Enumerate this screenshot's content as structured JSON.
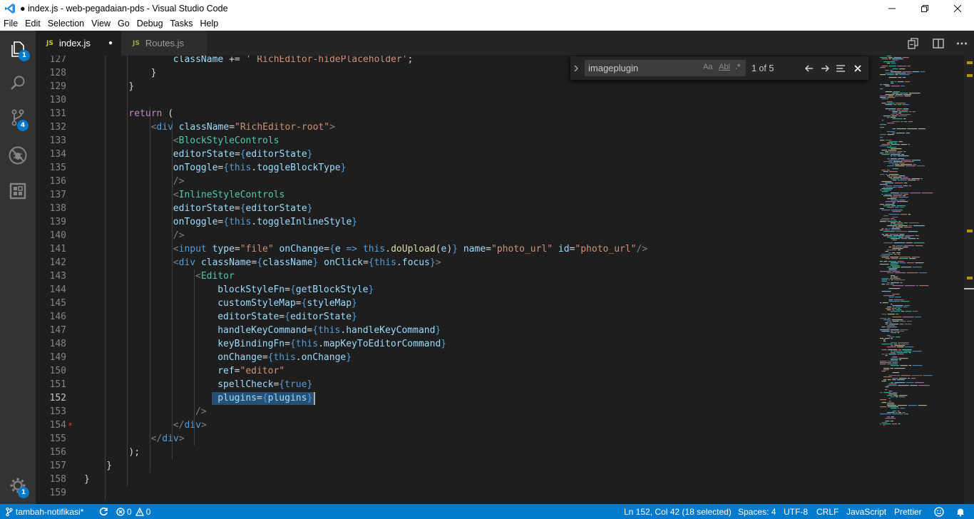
{
  "window": {
    "title": "● index.js - web-pegadaian-pds - Visual Studio Code",
    "controls": {
      "minimize": "—",
      "restore": "❐",
      "close": "✕"
    }
  },
  "menu": [
    "File",
    "Edit",
    "Selection",
    "View",
    "Go",
    "Debug",
    "Tasks",
    "Help"
  ],
  "activity": {
    "explorer_badge": "1",
    "scm_badge": "4",
    "settings_badge": "1"
  },
  "tabs": [
    {
      "icon": "JS",
      "label": "index.js",
      "dirty": "●"
    },
    {
      "icon": "JS",
      "label": "Routes.js"
    }
  ],
  "find": {
    "query": "imageplugin",
    "opt_case": "Aa",
    "opt_word": "Abl",
    "opt_regex": ".*",
    "match_count": "1 of 5"
  },
  "editor": {
    "current_line": "152",
    "lines": [
      {
        "n": "127",
        "indent": 4,
        "html": "<span class='t-var'>className</span> <span class='t-pun'>+=</span> <span class='t-str'>' RichEditor-hidePlaceholder'</span><span class='t-pun'>;</span>"
      },
      {
        "n": "128",
        "indent": 3,
        "html": "<span class='t-pun'>}</span>"
      },
      {
        "n": "129",
        "indent": 2,
        "html": "<span class='t-pun'>}</span>"
      },
      {
        "n": "130",
        "indent": 0,
        "html": ""
      },
      {
        "n": "131",
        "indent": 2,
        "html": "<span class='t-kw'>return</span> <span class='t-pun'>(</span>"
      },
      {
        "n": "132",
        "indent": 3,
        "html": "<span class='t-br'>&lt;</span><span class='t-tag'>div</span> <span class='t-attr'>className</span><span class='t-pun'>=</span><span class='t-str'>\"RichEditor-root\"</span><span class='t-br'>&gt;</span>"
      },
      {
        "n": "133",
        "indent": 4,
        "html": "<span class='t-br'>&lt;</span><span class='t-comp'>BlockStyleControls</span>"
      },
      {
        "n": "134",
        "indent": 4,
        "html": "<span class='t-attr'>editorState</span><span class='t-pun'>=</span><span class='t-tag'>{</span><span class='t-var'>editorState</span><span class='t-tag'>}</span>"
      },
      {
        "n": "135",
        "indent": 4,
        "html": "<span class='t-attr'>onToggle</span><span class='t-pun'>=</span><span class='t-tag'>{</span><span class='t-this'>this</span><span class='t-pun'>.</span><span class='t-var'>toggleBlockType</span><span class='t-tag'>}</span>"
      },
      {
        "n": "136",
        "indent": 4,
        "html": "<span class='t-br'>/&gt;</span>"
      },
      {
        "n": "137",
        "indent": 4,
        "html": "<span class='t-br'>&lt;</span><span class='t-comp'>InlineStyleControls</span>"
      },
      {
        "n": "138",
        "indent": 4,
        "html": "<span class='t-attr'>editorState</span><span class='t-pun'>=</span><span class='t-tag'>{</span><span class='t-var'>editorState</span><span class='t-tag'>}</span>"
      },
      {
        "n": "139",
        "indent": 4,
        "html": "<span class='t-attr'>onToggle</span><span class='t-pun'>=</span><span class='t-tag'>{</span><span class='t-this'>this</span><span class='t-pun'>.</span><span class='t-var'>toggleInlineStyle</span><span class='t-tag'>}</span>"
      },
      {
        "n": "140",
        "indent": 4,
        "html": "<span class='t-br'>/&gt;</span>"
      },
      {
        "n": "141",
        "indent": 4,
        "html": "<span class='t-br'>&lt;</span><span class='t-tag'>input</span> <span class='t-attr'>type</span><span class='t-pun'>=</span><span class='t-str'>\"file\"</span> <span class='t-attr'>onChange</span><span class='t-pun'>=</span><span class='t-tag'>{</span><span class='t-var'>e</span> <span class='t-tag'>=&gt;</span> <span class='t-this'>this</span><span class='t-pun'>.</span><span class='t-fn'>doUpload</span><span class='t-pun'>(</span><span class='t-var'>e</span><span class='t-pun'>)</span><span class='t-tag'>}</span> <span class='t-attr'>name</span><span class='t-pun'>=</span><span class='t-str'>\"photo_url\"</span> <span class='t-attr'>id</span><span class='t-pun'>=</span><span class='t-str'>\"photo_url\"</span><span class='t-br'>/&gt;</span>"
      },
      {
        "n": "142",
        "indent": 4,
        "html": "<span class='t-br'>&lt;</span><span class='t-tag'>div</span> <span class='t-attr'>className</span><span class='t-pun'>=</span><span class='t-tag'>{</span><span class='t-var'>className</span><span class='t-tag'>}</span> <span class='t-attr'>onClick</span><span class='t-pun'>=</span><span class='t-tag'>{</span><span class='t-this'>this</span><span class='t-pun'>.</span><span class='t-var'>focus</span><span class='t-tag'>}</span><span class='t-br'>&gt;</span>"
      },
      {
        "n": "143",
        "indent": 5,
        "html": "<span class='t-br'>&lt;</span><span class='t-comp'>Editor</span>"
      },
      {
        "n": "144",
        "indent": 6,
        "html": "<span class='t-attr'>blockStyleFn</span><span class='t-pun'>=</span><span class='t-tag'>{</span><span class='t-var'>getBlockStyle</span><span class='t-tag'>}</span>"
      },
      {
        "n": "145",
        "indent": 6,
        "html": "<span class='t-attr'>customStyleMap</span><span class='t-pun'>=</span><span class='t-tag'>{</span><span class='t-var'>styleMap</span><span class='t-tag'>}</span>"
      },
      {
        "n": "146",
        "indent": 6,
        "html": "<span class='t-attr'>editorState</span><span class='t-pun'>=</span><span class='t-tag'>{</span><span class='t-var'>editorState</span><span class='t-tag'>}</span>"
      },
      {
        "n": "147",
        "indent": 6,
        "html": "<span class='t-attr'>handleKeyCommand</span><span class='t-pun'>=</span><span class='t-tag'>{</span><span class='t-this'>this</span><span class='t-pun'>.</span><span class='t-var'>handleKeyCommand</span><span class='t-tag'>}</span>"
      },
      {
        "n": "148",
        "indent": 6,
        "html": "<span class='t-attr'>keyBindingFn</span><span class='t-pun'>=</span><span class='t-tag'>{</span><span class='t-this'>this</span><span class='t-pun'>.</span><span class='t-var'>mapKeyToEditorCommand</span><span class='t-tag'>}</span>"
      },
      {
        "n": "149",
        "indent": 6,
        "html": "<span class='t-attr'>onChange</span><span class='t-pun'>=</span><span class='t-tag'>{</span><span class='t-this'>this</span><span class='t-pun'>.</span><span class='t-var'>onChange</span><span class='t-tag'>}</span>"
      },
      {
        "n": "150",
        "indent": 6,
        "html": "<span class='t-attr'>ref</span><span class='t-pun'>=</span><span class='t-str'>\"editor\"</span>"
      },
      {
        "n": "151",
        "indent": 6,
        "html": "<span class='t-attr'>spellCheck</span><span class='t-pun'>=</span><span class='t-tag'>{</span><span class='t-this'>true</span><span class='t-tag'>}</span>"
      },
      {
        "n": "152",
        "indent": 6,
        "html": "<span class='t-attr'>plugins</span><span class='t-pun'>=</span><span class='t-tag'>{</span><span class='t-var'>plugins</span><span class='t-tag'>}</span>"
      },
      {
        "n": "153",
        "indent": 5,
        "html": "<span class='t-br'>/&gt;</span>"
      },
      {
        "n": "154",
        "indent": 4,
        "html": "<span class='t-br'>&lt;/</span><span class='t-tag'>div</span><span class='t-br'>&gt;</span>"
      },
      {
        "n": "155",
        "indent": 3,
        "html": "<span class='t-br'>&lt;/</span><span class='t-tag'>div</span><span class='t-br'>&gt;</span>"
      },
      {
        "n": "156",
        "indent": 2,
        "html": "<span class='t-pun'>);</span>"
      },
      {
        "n": "157",
        "indent": 1,
        "html": "<span class='t-pun'>}</span>"
      },
      {
        "n": "158",
        "indent": 0,
        "html": "<span class='t-pun'>}</span>"
      },
      {
        "n": "159",
        "indent": 0,
        "html": ""
      }
    ]
  },
  "status": {
    "branch": "tambah-notifikasi*",
    "errors": "0",
    "warnings": "0",
    "position": "Ln 152, Col 42 (18 selected)",
    "spaces": "Spaces: 4",
    "encoding": "UTF-8",
    "eol": "CRLF",
    "language": "JavaScript",
    "formatter": "Prettier"
  },
  "colors": {
    "accent": "#007acc",
    "badge": "#007acc",
    "selection": "#264f78"
  }
}
